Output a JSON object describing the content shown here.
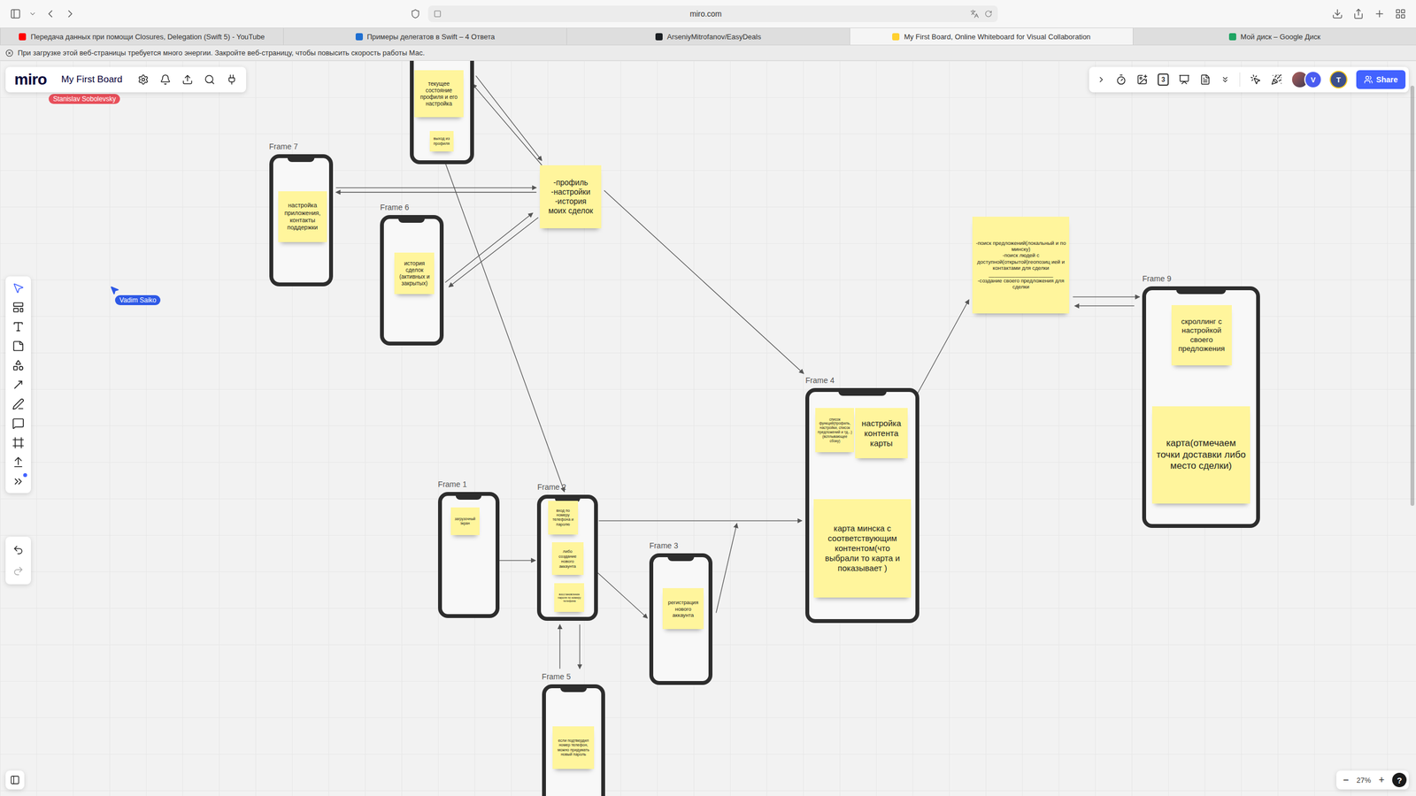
{
  "browser": {
    "url": "miro.com",
    "tabs": [
      {
        "label": "Передача данных при помощи Closures, Delegation (Swift 5) - YouTube",
        "selected": false,
        "color": "#ff0000"
      },
      {
        "label": "Примеры делегатов в Swift – 4 Ответа",
        "selected": false,
        "color": "#1f6fd1"
      },
      {
        "label": "ArseniyMitrofanov/EasyDeals",
        "selected": false,
        "color": "#1b1f23"
      },
      {
        "label": "My First Board, Online Whiteboard for Visual Collaboration",
        "selected": true,
        "color": "#ffd02f"
      },
      {
        "label": "Мой диск – Google Диск",
        "selected": false,
        "color": "#1fa463"
      }
    ],
    "notice": "При загрузке этой веб-страницы требуется много энергии. Закройте веб-страницу, чтобы повысить скорость работы Mac."
  },
  "board": {
    "logo": "miro",
    "title": "My First Board",
    "counter": "3",
    "share": "Share",
    "more_tools_badge": true,
    "avatars": [
      {
        "initial": "V",
        "color": "#4a5cf0",
        "ring": false
      },
      {
        "initial": "T",
        "color": "#3d4f8a",
        "ring": true
      }
    ],
    "zoom": {
      "out": "−",
      "value": "27%",
      "in": "+",
      "help": "?"
    }
  },
  "cursors": [
    {
      "name": "Stanislav Sobolevsky",
      "color": "#e8505b",
      "pointer": false
    },
    {
      "name": "Vadim Saiko",
      "color": "#2e59e6",
      "pointer": true
    }
  ],
  "frames": [
    {
      "stickies": [
        "текущее состояние профиля и его настройка",
        "выход из профиля"
      ]
    },
    {
      "label": "Frame 7",
      "stickies": [
        "настройка приложения, контакты поддержки"
      ]
    },
    {
      "label": "Frame 6",
      "stickies": [
        "история сделок (активных и закрытых)"
      ]
    },
    {
      "label": "Frame 4",
      "stickies": [
        "список функций(профиль, настройки, список предложений и тд...)(всплывающее сбоку)",
        "настройка контента карты",
        "карта минска с соответствующим контентом(что выбрали то карта и показывает )"
      ]
    },
    {
      "label": "Frame 9",
      "stickies": [
        "скроллинг с настройкой своего предложения",
        "карта(отмечаем точки доставки либо место сделки)"
      ]
    },
    {
      "label": "Frame 1",
      "stickies": [
        "загрузочный экран"
      ]
    },
    {
      "label": "Frame 2",
      "stickies": [
        "вход по номеру телефона и паролю",
        "либо создание нового аккаунта",
        "восстановление пароля по номеру телефона"
      ]
    },
    {
      "label": "Frame 3",
      "stickies": [
        "регистрация нового аккаунта"
      ]
    },
    {
      "label": "Frame 5",
      "stickies": [
        "если подтвердил номер телефон, можно придумать новый пароль"
      ]
    }
  ],
  "notes": [
    "-профиль\n-настройки\n-история\nмоих сделок",
    "-поиск предложений(локальный и по минску)\n-поиск людей с доступной(открытой)геопозиц ией и контактами для сделки\n______________________\n-создание своего предложения для сделки"
  ]
}
